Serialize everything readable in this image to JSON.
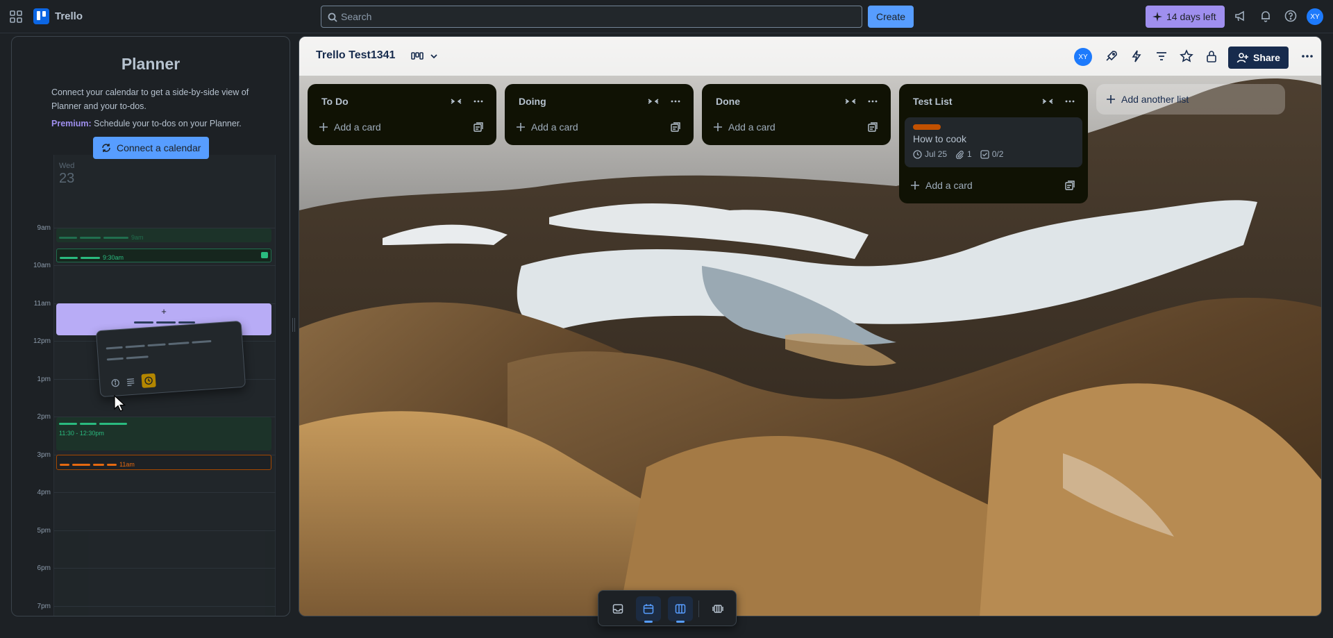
{
  "app": {
    "name": "Trello"
  },
  "topbar": {
    "search_placeholder": "Search",
    "create_label": "Create",
    "trial_label": "14 days left",
    "avatar_initials": "XY"
  },
  "planner": {
    "title": "Planner",
    "description": "Connect your calendar to get a side-by-side view of Planner and your to-dos.",
    "premium_label": "Premium:",
    "premium_text": "Schedule your to-dos on your Planner.",
    "connect_label": "Connect a calendar",
    "day_name": "Wed",
    "day_number": "23",
    "hours": [
      "9am",
      "10am",
      "11am",
      "12pm",
      "1pm",
      "2pm",
      "3pm",
      "4pm",
      "5pm",
      "6pm",
      "7pm"
    ],
    "events": {
      "e1_time": "9am",
      "e2_time": "9:30am",
      "e3_time": "11:30 - 12:30pm",
      "e4_time": "11am"
    }
  },
  "board": {
    "title": "Trello Test1341",
    "avatar_initials": "XY",
    "share_label": "Share",
    "add_list_label": "Add another list",
    "lists": [
      {
        "title": "To Do",
        "add_card_label": "Add a card"
      },
      {
        "title": "Doing",
        "add_card_label": "Add a card"
      },
      {
        "title": "Done",
        "add_card_label": "Add a card"
      },
      {
        "title": "Test List",
        "add_card_label": "Add a card",
        "cards": [
          {
            "title": "How to cook",
            "date": "Jul 25",
            "attachments": "1",
            "checklist": "0/2",
            "label_color": "#c25100"
          }
        ]
      }
    ]
  },
  "colors": {
    "accent": "#579dff",
    "premium": "#9f8fef",
    "list_bg": "#101204",
    "card_bg": "#22272b"
  },
  "icons": [
    "apps-grid-icon",
    "search-icon",
    "sparkle-icon",
    "megaphone-icon",
    "bell-icon",
    "help-icon",
    "calendar-sync-icon",
    "board-view-icon",
    "chevron-down-icon",
    "rocket-icon",
    "lightning-icon",
    "filter-icon",
    "star-icon",
    "lock-icon",
    "user-plus-icon",
    "more-icon",
    "collapse-icon",
    "plus-icon",
    "template-icon",
    "clock-icon",
    "paperclip-icon",
    "checklist-icon",
    "inbox-icon",
    "calendar-icon",
    "board-icon",
    "switch-boards-icon",
    "cursor-icon"
  ]
}
